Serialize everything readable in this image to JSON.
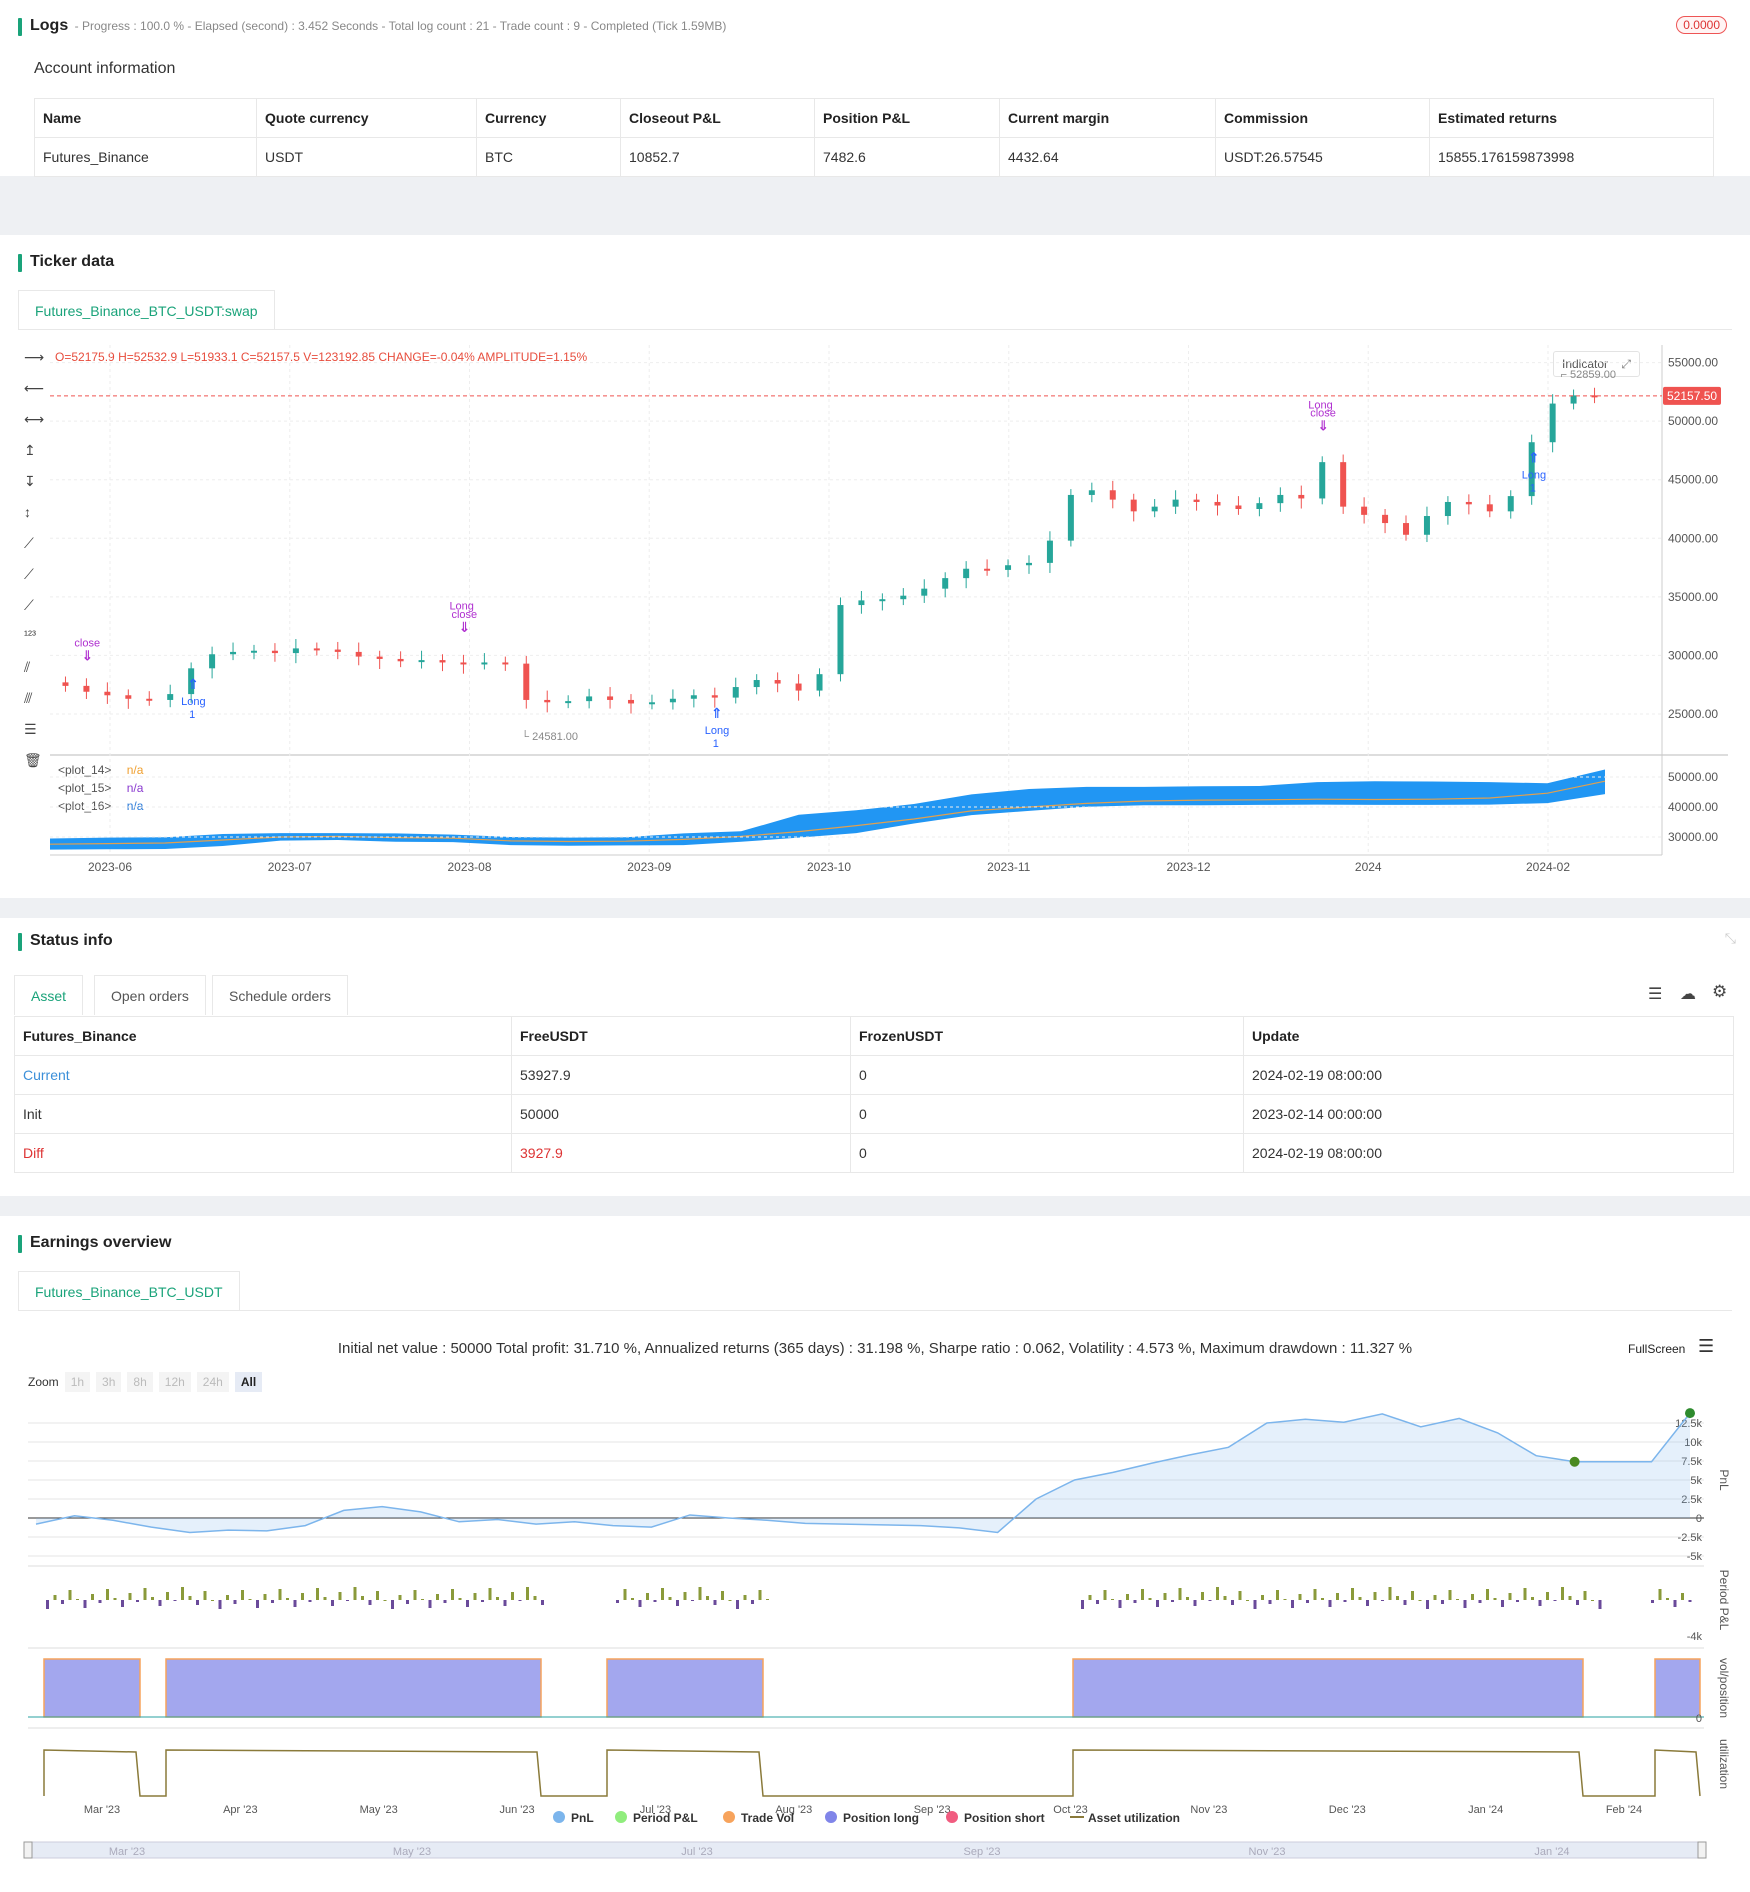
{
  "logs": {
    "title": "Logs",
    "status": "- Progress : 100.0 % - Elapsed (second) : 3.452  Seconds - Total log count : 21 - Trade count : 9 - Completed (Tick 1.59MB)",
    "badge": "0.0000"
  },
  "account": {
    "title": "Account information",
    "headers": [
      "Name",
      "Quote currency",
      "Currency",
      "Closeout P&L",
      "Position P&L",
      "Current margin",
      "Commission",
      "Estimated returns"
    ],
    "row": [
      "Futures_Binance",
      "USDT",
      "BTC",
      "10852.7",
      "7482.6",
      "4432.64",
      "USDT:26.57545",
      "15855.176159873998"
    ]
  },
  "ticker": {
    "title": "Ticker data",
    "tab": "Futures_Binance_BTC_USDT:swap",
    "ohlc": {
      "o": "O=52175.9",
      "h": "H=52532.9",
      "l": "L=51933.1",
      "c": "C=52157.5",
      "v": "V=123192.85",
      "change": "CHANGE=-0.04%",
      "amplitude": "AMPLITUDE=1.15%"
    },
    "indicator_btn": "Indicator",
    "last_price": "52157.50",
    "high_label": "52859.00",
    "low_label": "24581.00",
    "plots": [
      {
        "name": "<plot_14>",
        "value": "n/a",
        "color": "#f0a030"
      },
      {
        "name": "<plot_15>",
        "value": "n/a",
        "color": "#8a3ad0"
      },
      {
        "name": "<plot_16>",
        "value": "n/a",
        "color": "#2a7ad8"
      }
    ],
    "markers": {
      "long": "Long",
      "close": "close",
      "one": "1"
    },
    "colors": {
      "up": "#26a69a",
      "down": "#ef5350",
      "band": "#2196f3",
      "mid": "#e0a050"
    }
  },
  "chart_data": [
    {
      "type": "candlestick",
      "x_ticks": [
        "2023-06",
        "2023-07",
        "2023-08",
        "2023-09",
        "2023-10",
        "2023-11",
        "2023-12",
        "2024",
        "2024-02"
      ],
      "y_ticks": [
        25000,
        30000,
        35000,
        40000,
        45000,
        50000,
        55000
      ],
      "y_tick_labels": [
        "25000.00",
        "30000.00",
        "35000.00",
        "40000.00",
        "45000.00",
        "50000.00",
        "55000.00"
      ],
      "ylim": [
        21500,
        56500
      ],
      "close": [
        27400,
        26900,
        26600,
        26300,
        26200,
        26700,
        28900,
        30100,
        30300,
        30400,
        30200,
        30600,
        30500,
        30300,
        29900,
        29700,
        29500,
        29600,
        29400,
        29300,
        29400,
        29300,
        26200,
        26000,
        26100,
        26500,
        26200,
        25900,
        26000,
        26300,
        26600,
        26400,
        27300,
        27900,
        27600,
        27000,
        28400,
        34300,
        34700,
        34800,
        35100,
        35700,
        36600,
        37400,
        37300,
        37700,
        37900,
        39800,
        43700,
        44100,
        43300,
        42300,
        42700,
        43300,
        43100,
        42800,
        42500,
        43000,
        43700,
        43400,
        46500,
        42700,
        42000,
        41300,
        40300,
        41900,
        43100,
        42900,
        42300,
        43600,
        48200,
        51500,
        52200,
        52157.5
      ],
      "ylabel": ""
    },
    {
      "type": "area",
      "y_tick_labels": [
        "30000.00",
        "40000.00",
        "50000.00"
      ],
      "series": [
        {
          "name": "<plot_14>",
          "values": [
            27600,
            27800,
            28000,
            29000,
            30000,
            30200,
            29800,
            29600,
            28700,
            28500,
            28600,
            29200,
            30200,
            31800,
            33800,
            36000,
            38700,
            40000,
            41200,
            42000,
            42300,
            42400,
            42600,
            42500,
            42600,
            43000,
            44600,
            48600
          ]
        },
        {
          "name": "<plot_15>",
          "values": [
            29500,
            29800,
            29900,
            31000,
            31300,
            31300,
            31200,
            30800,
            30000,
            29800,
            29900,
            31200,
            31900,
            37400,
            38900,
            41000,
            44200,
            46000,
            46700,
            46700,
            46900,
            47000,
            48300,
            48600,
            48500,
            48300,
            47900,
            52500
          ]
        },
        {
          "name": "<plot_16>",
          "values": [
            25800,
            25900,
            26000,
            27000,
            28800,
            29000,
            28400,
            28300,
            27300,
            27100,
            27200,
            27300,
            28400,
            29800,
            31300,
            34500,
            37300,
            38700,
            40100,
            40600,
            40600,
            40700,
            40800,
            40700,
            40700,
            40800,
            41300,
            44300
          ]
        }
      ]
    },
    {
      "type": "line",
      "title": "Initial net value : 50000 Total profit: 31.710 %, Annualized returns (365 days) : 31.198 %, Sharpe ratio : 0.062, Volatility : 4.573 %, Maximum drawdown : 11.327 %",
      "x_ticks": [
        "Mar '23",
        "Apr '23",
        "May '23",
        "Jun '23",
        "Jul '23",
        "Aug '23",
        "Sep '23",
        "Oct '23",
        "Nov '23",
        "Dec '23",
        "Jan '24",
        "Feb '24"
      ],
      "y_ticks": [
        "-5k",
        "-2.5k",
        "0",
        "2.5k",
        "5k",
        "7.5k",
        "10k",
        "12.5k"
      ],
      "ylim": [
        -5000,
        15000
      ],
      "pnl": [
        -800,
        300,
        -300,
        -1200,
        -1900,
        -1600,
        -1700,
        -1000,
        1000,
        1500,
        800,
        -500,
        -200,
        -800,
        -500,
        -1000,
        -1200,
        400,
        0,
        -300,
        -700,
        -800,
        -900,
        -1000,
        -1300,
        -1900,
        2500,
        5000,
        6000,
        7200,
        8300,
        9300,
        12500,
        13000,
        12600,
        13700,
        12000,
        13100,
        11200,
        8200,
        7400,
        7400,
        7400,
        13800
      ],
      "series_legend": [
        "PnL",
        "Period P&L",
        "Trade Vol",
        "Position long",
        "Position short",
        "Asset utilization"
      ],
      "ylabels": [
        "PnL",
        "Period P&L",
        "vol/position",
        "utilization"
      ],
      "period_label": "-4k",
      "zero_label": "0"
    }
  ],
  "status": {
    "title": "Status info",
    "tabs": [
      "Asset",
      "Open orders",
      "Schedule orders"
    ],
    "headers": [
      "Futures_Binance",
      "FreeUSDT",
      "FrozenUSDT",
      "Update"
    ],
    "rows": [
      [
        "Current",
        "53927.9",
        "0",
        "2024-02-19 08:00:00"
      ],
      [
        "Init",
        "50000",
        "0",
        "2023-02-14 00:00:00"
      ],
      [
        "Diff",
        "3927.9",
        "0",
        "2024-02-19 08:00:00"
      ]
    ]
  },
  "earnings": {
    "title": "Earnings overview",
    "tab": "Futures_Binance_BTC_USDT",
    "fullscreen": "FullScreen",
    "zoom_label": "Zoom",
    "zoom_options": [
      "1h",
      "3h",
      "8h",
      "12h",
      "24h",
      "All"
    ],
    "navigator_ticks": [
      "Mar '23",
      "May '23",
      "Jul '23",
      "Sep '23",
      "Nov '23",
      "Jan '24"
    ],
    "legend_colors": [
      "#7cb5ec",
      "#90ed7d",
      "#f7a35c",
      "#8085e9",
      "#f15c80",
      "#8a7a3a"
    ]
  }
}
